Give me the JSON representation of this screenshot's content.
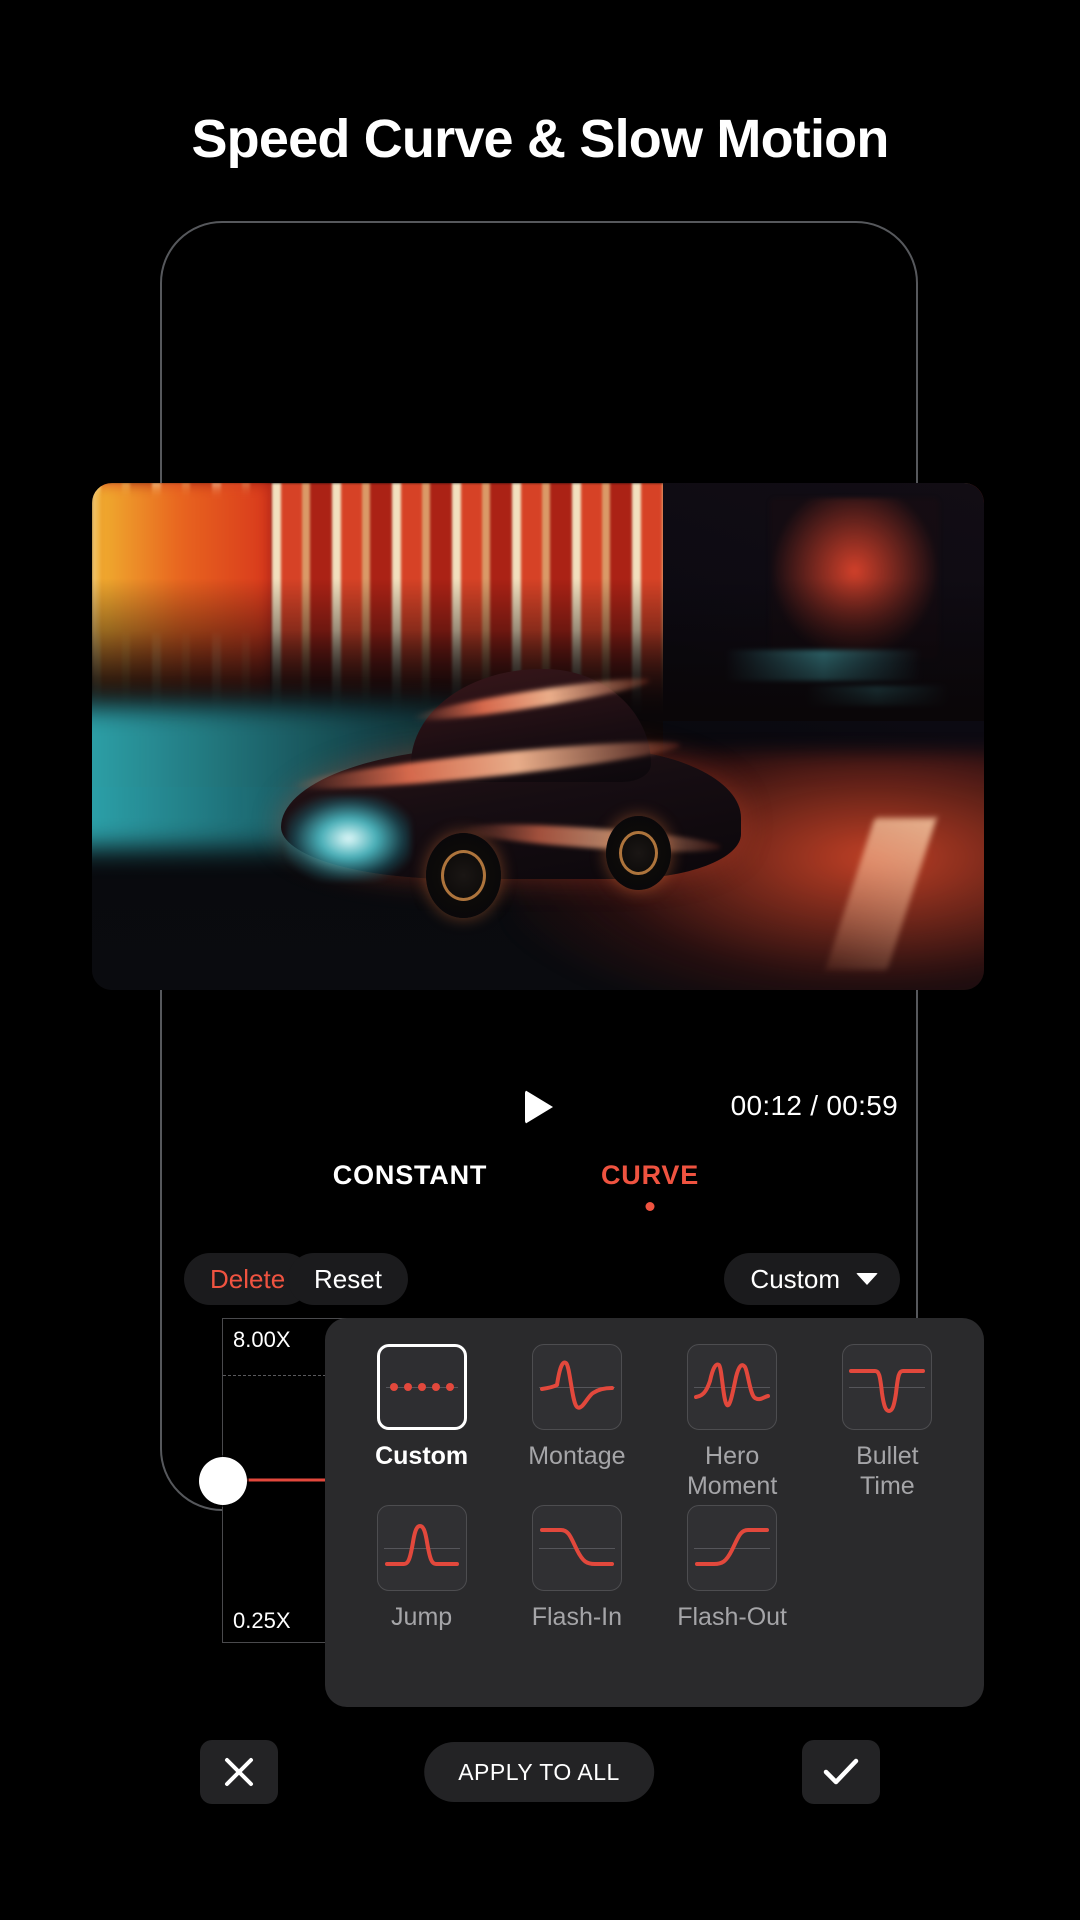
{
  "headline": "Speed Curve & Slow Motion",
  "player": {
    "play_icon": "play-icon",
    "current_time": "00:12",
    "separator": "/",
    "total_time": "00:59",
    "timecode": "00:12 / 00:59"
  },
  "tabs": [
    {
      "label": "CONSTANT",
      "active": false,
      "color": "#ffffff"
    },
    {
      "label": "CURVE",
      "active": true,
      "color": "#ef5340"
    }
  ],
  "controls": {
    "delete_label": "Delete",
    "delete_color": "#ef5340",
    "reset_label": "Reset",
    "preset_select_label": "Custom",
    "chevron_icon": "chevron-down-icon"
  },
  "graph": {
    "max_speed_label": "8.00X",
    "min_speed_label": "0.25X",
    "handle_icon": "curve-keyframe-handle",
    "curve_color": "#e2483c"
  },
  "presets": {
    "selected": "Custom",
    "items": [
      {
        "label": "Custom",
        "icon": "curve-custom-dots-icon",
        "selected": true
      },
      {
        "label": "Montage",
        "icon": "curve-montage-icon",
        "selected": false
      },
      {
        "label": "Hero\nMoment",
        "icon": "curve-hero-moment-icon",
        "selected": false
      },
      {
        "label": "Bullet\nTime",
        "icon": "curve-bullet-time-icon",
        "selected": false
      },
      {
        "label": "Jump",
        "icon": "curve-jump-icon",
        "selected": false
      },
      {
        "label": "Flash-In",
        "icon": "curve-flash-in-icon",
        "selected": false
      },
      {
        "label": "Flash-\nOut",
        "icon": "curve-flash-out-icon",
        "selected": false
      }
    ],
    "labels": {
      "custom": "Custom",
      "montage": "Montage",
      "hero_moment": "Hero Moment",
      "bullet_time": "Bullet Time",
      "jump": "Jump",
      "flash_in": "Flash-In",
      "flash_out": "Flash-Out"
    }
  },
  "actions": {
    "cancel_icon": "close-x-icon",
    "apply_all_label": "APPLY TO ALL",
    "confirm_icon": "checkmark-icon"
  },
  "colors": {
    "accent": "#ef5340",
    "curve_stroke": "#e2483c",
    "background": "#000000",
    "panel": "#2a2a2c",
    "pill": "#1b1b1d",
    "muted_text": "#a5a5a8"
  }
}
